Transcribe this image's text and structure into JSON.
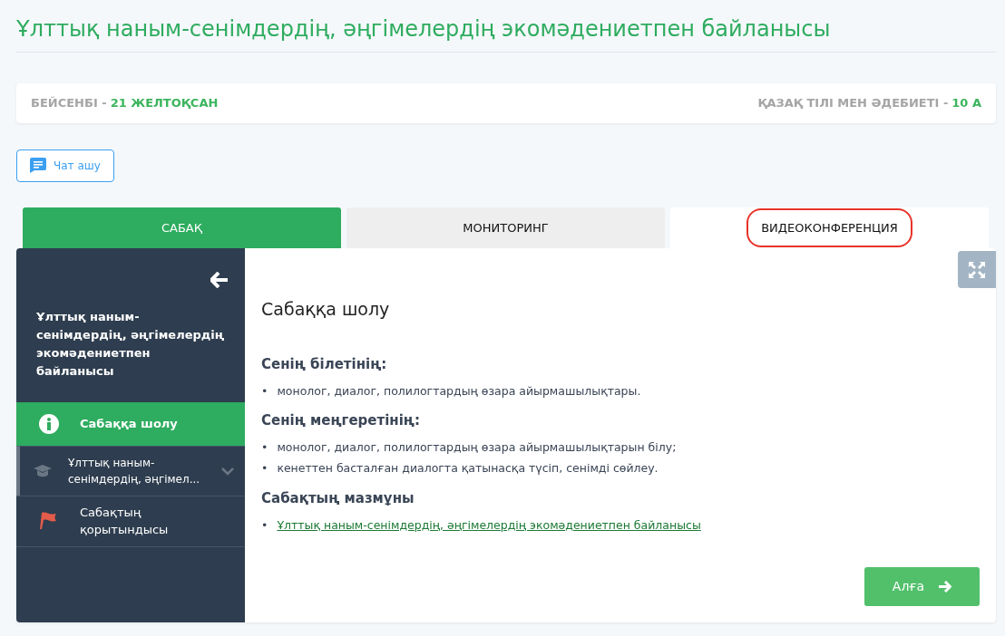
{
  "page_title": "Ұлттық наным-сенімдердің, әңгімелердің экомәдениетпен байланысы",
  "info_bar": {
    "day_label": "БЕЙСЕНБІ - ",
    "day_value": "21 ЖЕЛТОҚСАН",
    "subject_label": "ҚАЗАҚ ТІЛІ МЕН ӘДЕБИЕТІ - ",
    "subject_value": "10 А"
  },
  "chat_button": "Чат ашу",
  "tabs": [
    {
      "label": "САБАҚ",
      "selected": true,
      "shaded": false,
      "circled": false
    },
    {
      "label": "МОНИТОРИНГ",
      "selected": false,
      "shaded": true,
      "circled": false
    },
    {
      "label": "ВИДЕОКОНФЕРЕНЦИЯ",
      "selected": false,
      "shaded": false,
      "circled": true
    }
  ],
  "sidebar": {
    "title": "Ұлттық наным-сенімдердің, әңгімелердің экомәдениетпен байланысы",
    "items": [
      {
        "kind": "info",
        "label": "Сабаққа шолу",
        "selected": true,
        "expandable": false
      },
      {
        "kind": "lesson",
        "label": "Ұлттық наным-сенімдердің, әңгімел...",
        "selected": false,
        "expandable": true
      },
      {
        "kind": "flag",
        "label": "Сабақтың қорытындысы",
        "selected": false,
        "expandable": false
      }
    ]
  },
  "content": {
    "heading": "Сабаққа шолу",
    "bullet": "•",
    "sections": [
      {
        "title": "Сенің білетінің:",
        "kind": "text",
        "items": [
          "монолог, диалог, полилогтардың өзара айырмашылықтары."
        ]
      },
      {
        "title": "Сенің меңгеретінің:",
        "kind": "text",
        "items": [
          "монолог, диалог, полилогтардың өзара айырмашылықтарын білу;",
          "кенеттен басталған диалогта қатынасқа түсіп, сенімді сөйлеу."
        ]
      },
      {
        "title": "Сабақтың мазмұны",
        "kind": "link",
        "items": [
          "Ұлттық наным-сенімдердің, әңгімелердің экомәдениетпен байланысы"
        ]
      }
    ],
    "next_button": "Алға"
  }
}
